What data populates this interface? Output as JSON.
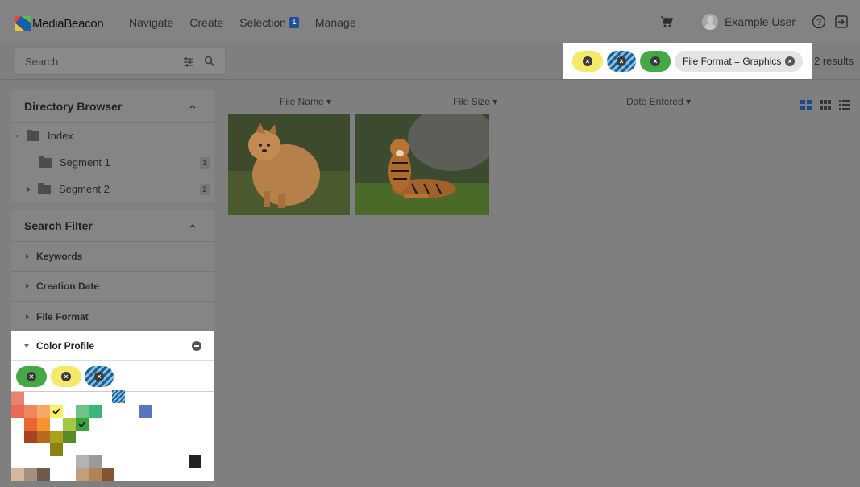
{
  "app": {
    "logo_text": "MediaBeacon"
  },
  "nav": {
    "items": [
      "Navigate",
      "Create",
      "Selection",
      "Manage"
    ],
    "selection_count": "1"
  },
  "header": {
    "user_name": "Example User"
  },
  "search": {
    "placeholder": "Search"
  },
  "active_filters": {
    "pills": [
      {
        "color": "#f4e96a",
        "kind": "yellow"
      },
      {
        "color": "#6fa3c8",
        "kind": "striped"
      },
      {
        "color": "#44a845",
        "kind": "green"
      }
    ],
    "format_filter": "File Format = Graphics",
    "results": "2 results"
  },
  "directory": {
    "title": "Directory Browser",
    "items": [
      {
        "label": "Index"
      },
      {
        "label": "Segment 1",
        "count": "1"
      },
      {
        "label": "Segment 2",
        "count": "2"
      }
    ]
  },
  "search_filter": {
    "title": "Search Filter",
    "items": [
      "Keywords",
      "Creation Date",
      "File Format"
    ],
    "color_profile": "Color Profile"
  },
  "color_profile_pills": [
    {
      "color": "#44a845",
      "kind": "green"
    },
    {
      "color": "#f4e96a",
      "kind": "yellow"
    },
    {
      "color": "#6fa3c8",
      "kind": "striped"
    }
  ],
  "color_swatches": [
    "#e8836f",
    "#e96a56",
    "#f0875b",
    "#f4a967",
    "#f8f263",
    "#6fc38a",
    "#3bb57a",
    "#5875c0",
    "#ea6530",
    "#f4942c",
    "#a5c745",
    "#3aa33a",
    "#a9421e",
    "#b76a1f",
    "#a8a21b",
    "#5b8a2a",
    "#88840f",
    "#b3b3b3",
    "#9a9a9a",
    "#222222",
    "#d5b79c",
    "#a58f7d",
    "#6d5b4e",
    "#c39e79",
    "#b18356",
    "#845432"
  ],
  "columns": {
    "file_name": "File Name",
    "file_size": "File Size",
    "date_entered": "Date Entered"
  },
  "thumbnails": [
    {
      "subject": "pomeranian dog"
    },
    {
      "subject": "tiger"
    }
  ]
}
